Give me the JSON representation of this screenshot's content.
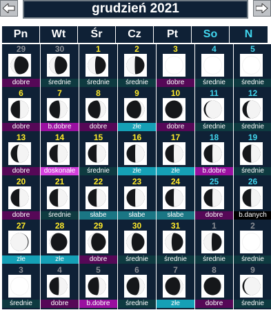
{
  "title": "grudzień 2021",
  "days": [
    "Pn",
    "Wt",
    "Śr",
    "Cz",
    "Pt",
    "So",
    "N"
  ],
  "colors": {
    "dobre": "#560857",
    "b.dobre": "#9a0fa0",
    "doskonałe": "#d43fdc",
    "średnie": "#0e3a40",
    "złe": "#15a0b6",
    "słabe": "#1a7684",
    "b.danych": "#000000"
  },
  "cells": [
    {
      "day": "29",
      "status": "dobre",
      "other": true,
      "phase": 0.15
    },
    {
      "day": "30",
      "status": "średnie",
      "other": true,
      "phase": 0.1
    },
    {
      "day": "1",
      "status": "średnie",
      "other": false,
      "phase": 0.05
    },
    {
      "day": "2",
      "status": "średnie",
      "other": false,
      "phase": 0.02
    },
    {
      "day": "3",
      "status": "dobre",
      "other": false,
      "phase": 0.0
    },
    {
      "day": "4",
      "status": "średnie",
      "other": false,
      "phase": 0.0
    },
    {
      "day": "5",
      "status": "średnie",
      "other": false,
      "phase": 0.0
    },
    {
      "day": "6",
      "status": "dobre",
      "other": false,
      "phase": 0.99
    },
    {
      "day": "7",
      "status": "b.dobre",
      "other": false,
      "phase": 0.95
    },
    {
      "day": "8",
      "status": "dobre",
      "other": false,
      "phase": 0.9
    },
    {
      "day": "9",
      "status": "złe",
      "other": false,
      "phase": 0.84
    },
    {
      "day": "10",
      "status": "dobre",
      "other": false,
      "phase": 0.77
    },
    {
      "day": "11",
      "status": "średnie",
      "other": false,
      "phase": 0.7
    },
    {
      "day": "12",
      "status": "średnie",
      "other": false,
      "phase": 0.63
    },
    {
      "day": "13",
      "status": "dobre",
      "other": false,
      "phase": 0.57
    },
    {
      "day": "14",
      "status": "doskonałe",
      "other": false,
      "phase": 0.52
    },
    {
      "day": "15",
      "status": "średnie",
      "other": false,
      "phase": 0.5
    },
    {
      "day": "16",
      "status": "złe",
      "other": false,
      "phase": 0.5
    },
    {
      "day": "17",
      "status": "złe",
      "other": false,
      "phase": 0.5
    },
    {
      "day": "18",
      "status": "b.dobre",
      "other": false,
      "phase": 0.5
    },
    {
      "day": "19",
      "status": "średnie",
      "other": false,
      "phase": 0.5
    },
    {
      "day": "20",
      "status": "dobre",
      "other": false,
      "phase": 0.5
    },
    {
      "day": "21",
      "status": "średnie",
      "other": false,
      "phase": 0.5
    },
    {
      "day": "22",
      "status": "słabe",
      "other": false,
      "phase": 0.5
    },
    {
      "day": "23",
      "status": "słabe",
      "other": false,
      "phase": 0.5
    },
    {
      "day": "24",
      "status": "słabe",
      "other": false,
      "phase": 0.5
    },
    {
      "day": "25",
      "status": "dobre",
      "other": false,
      "phase": 0.5
    },
    {
      "day": "26",
      "status": "b.danych",
      "other": false,
      "phase": 0.5
    },
    {
      "day": "27",
      "status": "złe",
      "other": false,
      "phase": 0.27
    },
    {
      "day": "28",
      "status": "złe",
      "other": false,
      "phase": 0.21
    },
    {
      "day": "29",
      "status": "dobre",
      "other": false,
      "phase": 0.16
    },
    {
      "day": "30",
      "status": "średnie",
      "other": false,
      "phase": 0.11
    },
    {
      "day": "31",
      "status": "średnie",
      "other": false,
      "phase": 0.07
    },
    {
      "day": "1",
      "status": "średnie",
      "other": true,
      "phase": 0.03
    },
    {
      "day": "2",
      "status": "średnie",
      "other": true,
      "phase": 0.0
    },
    {
      "day": "3",
      "status": "średnie",
      "other": true,
      "phase": 0.0
    },
    {
      "day": "4",
      "status": "dobre",
      "other": true,
      "phase": 0.98
    },
    {
      "day": "5",
      "status": "b.dobre",
      "other": true,
      "phase": 0.94
    },
    {
      "day": "6",
      "status": "średnie",
      "other": true,
      "phase": 0.89
    },
    {
      "day": "7",
      "status": "złe",
      "other": true,
      "phase": 0.83
    },
    {
      "day": "8",
      "status": "dobre",
      "other": true,
      "phase": 0.77
    },
    {
      "day": "9",
      "status": "średnie",
      "other": true,
      "phase": 0.7
    }
  ]
}
